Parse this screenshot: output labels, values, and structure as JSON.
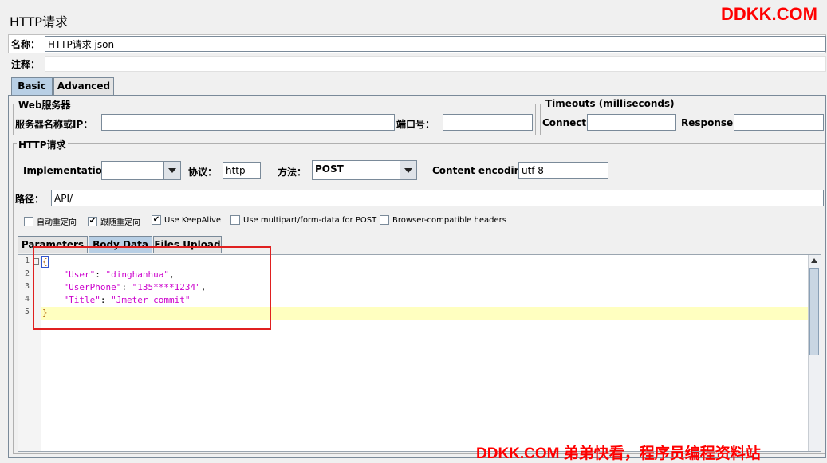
{
  "window": {
    "title": "HTTP请求"
  },
  "watermark": {
    "top": "DDKK.COM",
    "bottom": "DDKK.COM 弟弟快看，程序员编程资料站"
  },
  "name_row": {
    "label": "名称：",
    "value": "HTTP请求 json"
  },
  "comment_row": {
    "label": "注释：",
    "value": ""
  },
  "top_tabs": [
    {
      "label": "Basic",
      "active": true
    },
    {
      "label": "Advanced",
      "active": false
    }
  ],
  "web_server": {
    "title": "Web服务器",
    "server_label": "服务器名称或IP：",
    "server_value": "",
    "port_label": "端口号：",
    "port_value": ""
  },
  "timeouts": {
    "title": "Timeouts (milliseconds)",
    "connect_label": "Connect:",
    "connect_value": "",
    "response_label": "Response:",
    "response_value": ""
  },
  "http_request": {
    "title": "HTTP请求",
    "implementation_label": "Implementation:",
    "implementation_value": "",
    "protocol_label": "协议：",
    "protocol_value": "http",
    "method_label": "方法：",
    "method_value": "POST",
    "encoding_label": "Content encoding:",
    "encoding_value": "utf-8",
    "path_label": "路径：",
    "path_value": "API/"
  },
  "options": [
    {
      "label": "自动重定向",
      "checked": false
    },
    {
      "label": "跟随重定向",
      "checked": true
    },
    {
      "label": "Use KeepAlive",
      "checked": true
    },
    {
      "label": "Use multipart/form-data for POST",
      "checked": false
    },
    {
      "label": "Browser-compatible headers",
      "checked": false
    }
  ],
  "body_tabs": [
    {
      "label": "Parameters",
      "active": false
    },
    {
      "label": "Body Data",
      "active": true
    },
    {
      "label": "Files Upload",
      "active": false
    }
  ],
  "editor": {
    "line_numbers": [
      "1",
      "2",
      "3",
      "4",
      "5"
    ],
    "lines": {
      "l1": "{",
      "l2_key": "\"User\"",
      "l2_sep": ": ",
      "l2_val": "\"dinghanhua\"",
      "l2_end": ",",
      "l3_key": "\"UserPhone\"",
      "l3_sep": ": ",
      "l3_val": "\"135****1234\"",
      "l3_end": ",",
      "l4_key": "\"Title\"",
      "l4_sep": ": ",
      "l4_val": "\"Jmeter commit\"",
      "l5": "}"
    }
  },
  "colors": {
    "highlight_line": "#ffffc0",
    "annotation_box": "#e02020",
    "json_text": "#cc00cc"
  }
}
